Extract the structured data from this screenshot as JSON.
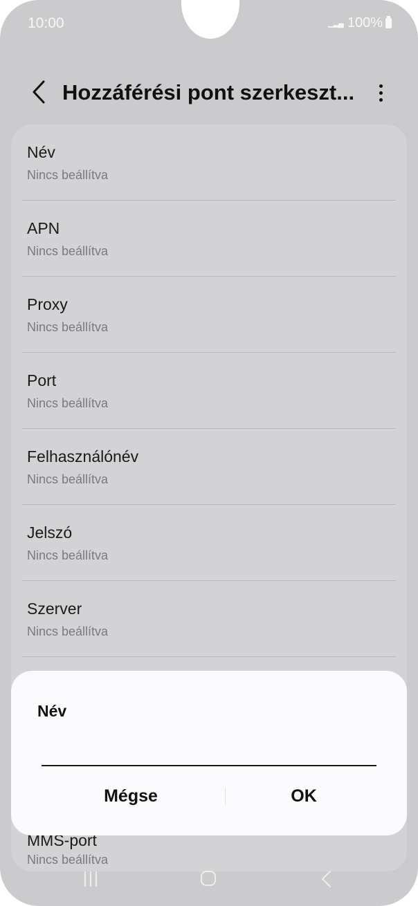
{
  "status_bar": {
    "time": "10:00",
    "battery": "100%"
  },
  "header": {
    "title": "Hozzáférési pont szerkeszt..."
  },
  "list": [
    {
      "title": "Név",
      "subtitle": "Nincs beállítva"
    },
    {
      "title": "APN",
      "subtitle": "Nincs beállítva"
    },
    {
      "title": "Proxy",
      "subtitle": "Nincs beállítva"
    },
    {
      "title": "Port",
      "subtitle": "Nincs beállítva"
    },
    {
      "title": "Felhasználónév",
      "subtitle": "Nincs beállítva"
    },
    {
      "title": "Jelszó",
      "subtitle": "Nincs beállítva"
    },
    {
      "title": "Szerver",
      "subtitle": "Nincs beállítva"
    },
    {
      "title": "MMS-port",
      "subtitle": "Nincs beállítva"
    }
  ],
  "dialog": {
    "title": "Név",
    "input_value": "",
    "cancel_label": "Mégse",
    "ok_label": "OK"
  },
  "icons": {
    "back": "chevron-left-icon",
    "more": "more-vertical-icon",
    "nav_recents": "recents-icon",
    "nav_home": "home-icon",
    "nav_back": "back-icon"
  }
}
